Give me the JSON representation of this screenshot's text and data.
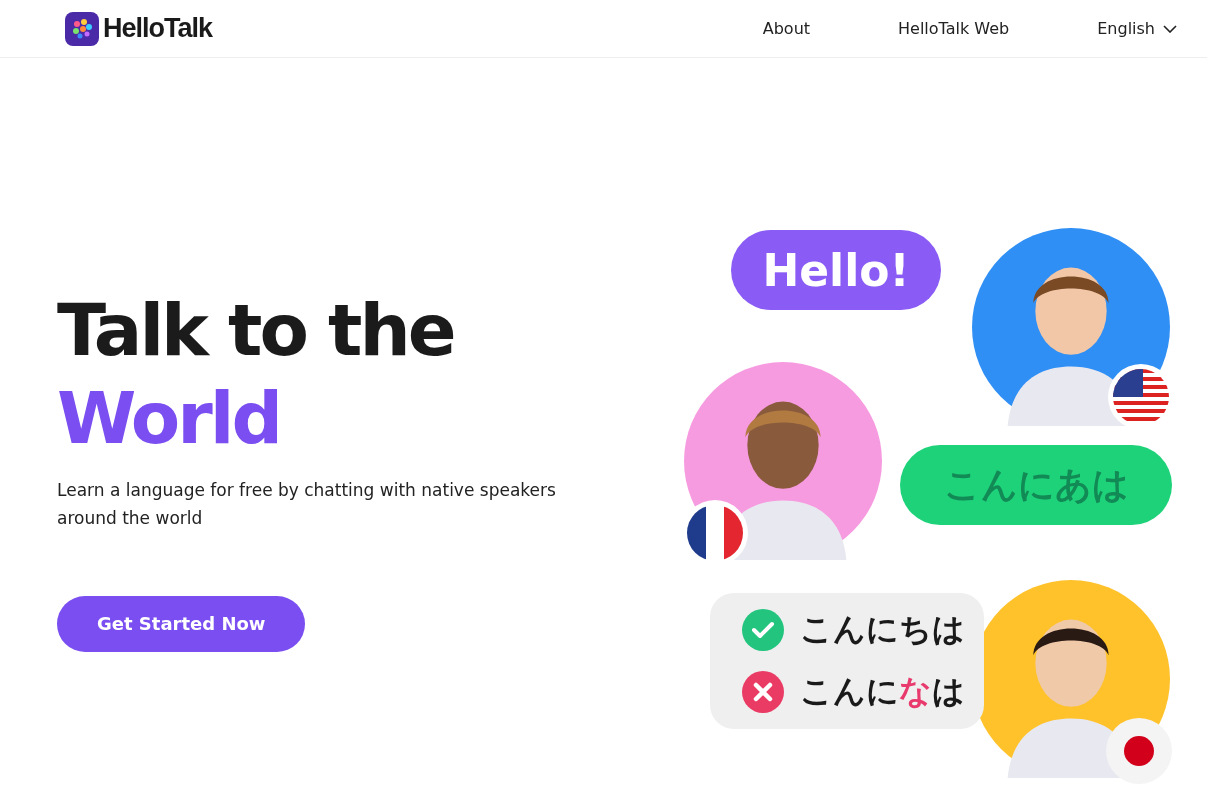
{
  "header": {
    "logo": "HelloTalk",
    "nav": [
      {
        "label": "About"
      },
      {
        "label": "HelloTalk Web"
      }
    ],
    "language": "English"
  },
  "hero": {
    "title_line_1": "Talk to the",
    "title_line_2": "World",
    "subtitle": "Learn a language for free by chatting with native speakers around the world",
    "cta": "Get Started Now"
  },
  "illustration": {
    "bubble_hello": "Hello!",
    "bubble_japanese": "こんにあは",
    "answers": [
      {
        "parts": [
          {
            "text": "こんにちは",
            "highlight": false
          }
        ],
        "correct": true
      },
      {
        "parts": [
          {
            "text": "こんに",
            "highlight": false
          },
          {
            "text": "な",
            "highlight": true
          },
          {
            "text": "は",
            "highlight": false
          }
        ],
        "correct": false
      }
    ]
  }
}
